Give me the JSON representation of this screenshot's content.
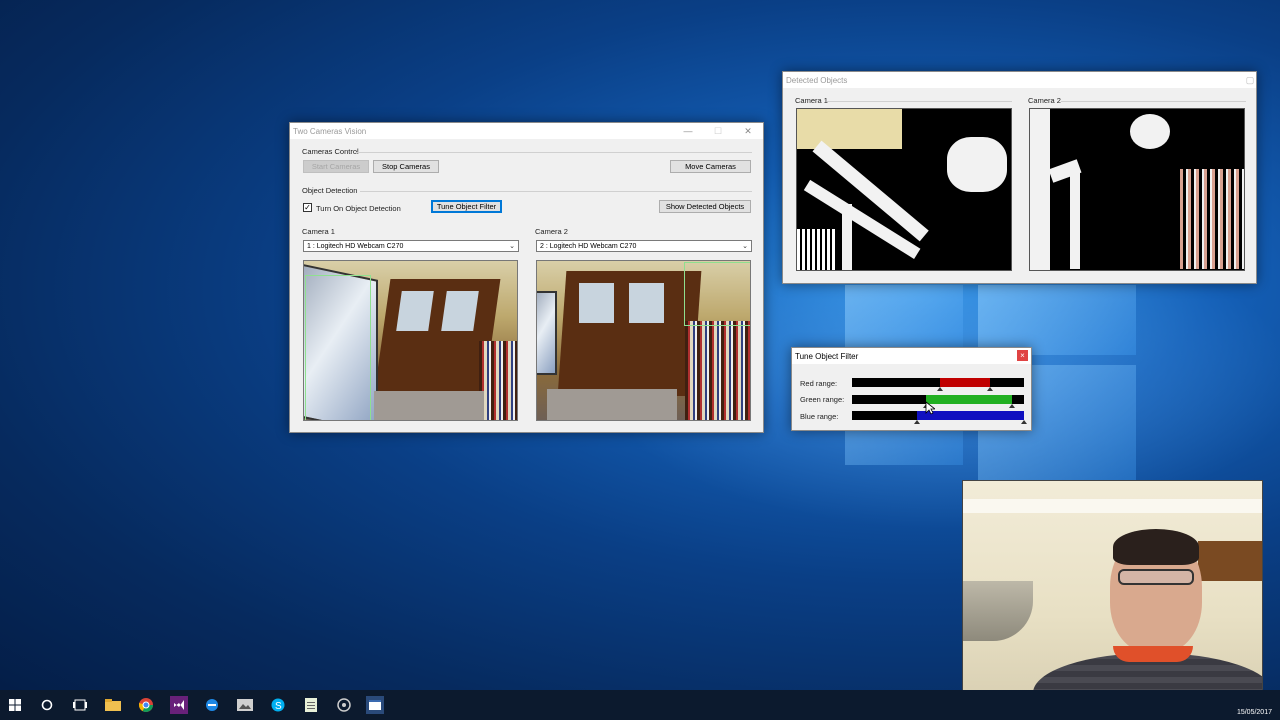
{
  "main_window": {
    "title": "Two Cameras Vision",
    "cameras_control_label": "Cameras Control",
    "start_label": "Start Cameras",
    "stop_label": "Stop Cameras",
    "move_label": "Move Cameras",
    "object_detection_label": "Object Detection",
    "turn_on_label": "Turn On Object Detection",
    "turn_on_checked": true,
    "tune_label": "Tune Object Filter",
    "show_detected_label": "Show Detected Objects",
    "camera1_label": "Camera 1",
    "camera2_label": "Camera 2",
    "camera1_device": "1 : Logitech HD Webcam C270",
    "camera2_device": "2 : Logitech HD Webcam C270"
  },
  "detected_window": {
    "title": "Detected Objects",
    "camera1_label": "Camera 1",
    "camera2_label": "Camera 2"
  },
  "tune_window": {
    "title": "Tune Object Filter",
    "close_glyph": "×",
    "sliders": [
      {
        "label": "Red range:",
        "color": "#c00000",
        "min": 0.51,
        "max": 0.8
      },
      {
        "label": "Green range:",
        "color": "#22b022",
        "min": 0.43,
        "max": 0.93
      },
      {
        "label": "Blue range:",
        "color": "#1010c0",
        "min": 0.38,
        "max": 1.0
      }
    ]
  },
  "taskbar": {
    "icons": [
      "windows-start-icon",
      "cortana-icon",
      "task-view-icon",
      "file-explorer-icon",
      "chrome-icon",
      "visual-studio-icon",
      "edge-icon",
      "photos-icon",
      "skype-icon",
      "notepad-icon",
      "settings-icon",
      "app-window-icon"
    ],
    "date": "15/05/2017"
  },
  "colors": {
    "accent": "#0078d7",
    "desktop_blue": "#0a3f86"
  }
}
